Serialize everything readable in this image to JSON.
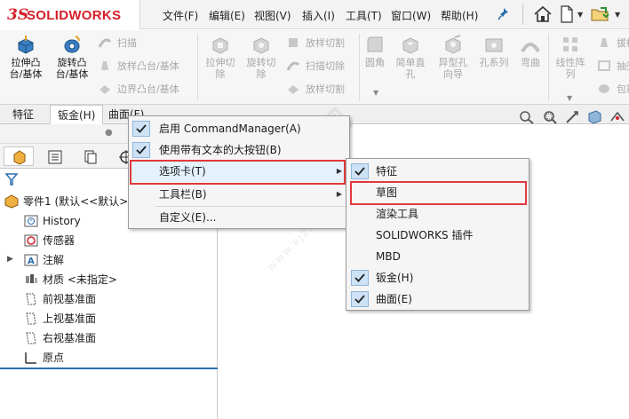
{
  "app": {
    "logo_text": "SOLIDWORKS",
    "logo_mark": "3S"
  },
  "menubar": {
    "items": [
      {
        "label": "文件(F)"
      },
      {
        "label": "编辑(E)"
      },
      {
        "label": "视图(V)"
      },
      {
        "label": "插入(I)"
      },
      {
        "label": "工具(T)"
      },
      {
        "label": "窗口(W)"
      },
      {
        "label": "帮助(H)"
      }
    ]
  },
  "ribbon": {
    "extrude_boss_label": "拉伸凸\n台/基体",
    "revolve_boss_label": "旋转凸\n台/基体",
    "sweep_label": "扫描",
    "loft_boss_label": "放样凸台/基体",
    "boundary_boss_label": "边界凸台/基体",
    "extrude_cut_label": "拉伸切\n除",
    "revolve_cut_label": "旋转切\n除",
    "loft_cut_label": "放样切割",
    "sweep_cut_label": "扫描切除",
    "boundary_cut_label": "放样切割",
    "fillet_label": "圆角",
    "simple_hole_label": "简单直\n孔",
    "hole_wizard_label": "异型孔\n向导",
    "hole_series_label": "孔系列",
    "bend_label": "弯曲",
    "linear_pattern_label": "线性阵\n列",
    "draft_label": "拔模",
    "shell_label": "抽壳",
    "wrap_label": "包覆"
  },
  "tabs": [
    {
      "label": "特征"
    },
    {
      "label": "钣金(H)"
    },
    {
      "label": "曲面(F)"
    }
  ],
  "tree": {
    "part_label": "零件1 (默认<<默认>",
    "items": [
      {
        "label": "History"
      },
      {
        "label": "传感器"
      },
      {
        "label": "注解"
      },
      {
        "label": "材质 <未指定>"
      },
      {
        "label": "前视基准面"
      },
      {
        "label": "上视基准面"
      },
      {
        "label": "右视基准面"
      },
      {
        "label": "原点"
      }
    ]
  },
  "menu1": {
    "items": [
      {
        "label": "启用 CommandManager(A)",
        "checked": true
      },
      {
        "label": "使用带有文本的大按钮(B)",
        "checked": true
      },
      {
        "label": "选项卡(T)",
        "submenu": true
      },
      {
        "label": "工具栏(B)",
        "submenu": true
      },
      {
        "label": "自定义(E)..."
      }
    ]
  },
  "menu2": {
    "items": [
      {
        "label": "特征",
        "checked": true
      },
      {
        "label": "草图",
        "checked": false
      },
      {
        "label": "渲染工具",
        "checked": false
      },
      {
        "label": "SOLIDWORKS 插件",
        "checked": false
      },
      {
        "label": "MBD",
        "checked": false
      },
      {
        "label": "钣金(H)",
        "checked": true
      },
      {
        "label": "曲面(E)",
        "checked": true
      }
    ]
  },
  "watermark": {
    "text": "软件自学网",
    "subtext": "WWW.RJZXW.COM"
  },
  "colors": {
    "accent_red": "#e03a3a",
    "brand_red": "#d4202a",
    "check_bg": "#cde3f5",
    "selection_blue": "#2a6fb0"
  }
}
